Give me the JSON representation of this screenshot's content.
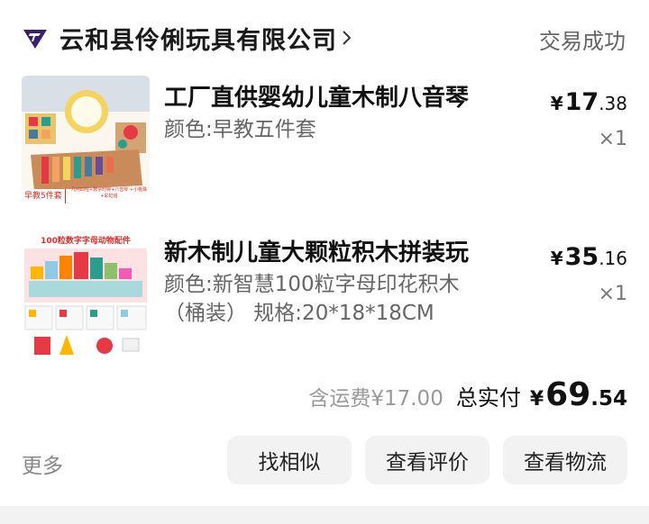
{
  "shop": {
    "name": "云和县伶俐玩具有限公司",
    "status": "交易成功"
  },
  "items": [
    {
      "title": "工厂直供婴幼儿童木制八音琴",
      "spec": "颜色:早教五件套",
      "price_yen": "¥",
      "price_main": "17",
      "price_cents": ".38",
      "qty": "×1",
      "thumb_caption": "早教5件套",
      "thumb_sub": "几何四柱+数字时钟+八音琴 +小桃珠+彩虹塔"
    },
    {
      "title": "新木制儿童大颗粒积木拼装玩",
      "spec": "颜色:新智慧100粒字母印花积木（桶装） 规格:20*18*18CM",
      "price_yen": "¥",
      "price_main": "35",
      "price_cents": ".16",
      "qty": "×1",
      "thumb_caption": "100粒数字字母动物配件"
    }
  ],
  "summary": {
    "shipping": "含运费¥17.00",
    "paid_label": "总实付",
    "paid_yen": "¥",
    "paid_main": "69",
    "paid_cents": ".54"
  },
  "actions": {
    "more": "更多",
    "similar": "找相似",
    "review": "查看评价",
    "logistics": "查看物流"
  },
  "colors": {
    "brand_icon": "#3b1f6e",
    "accent_red": "#d9302a"
  }
}
